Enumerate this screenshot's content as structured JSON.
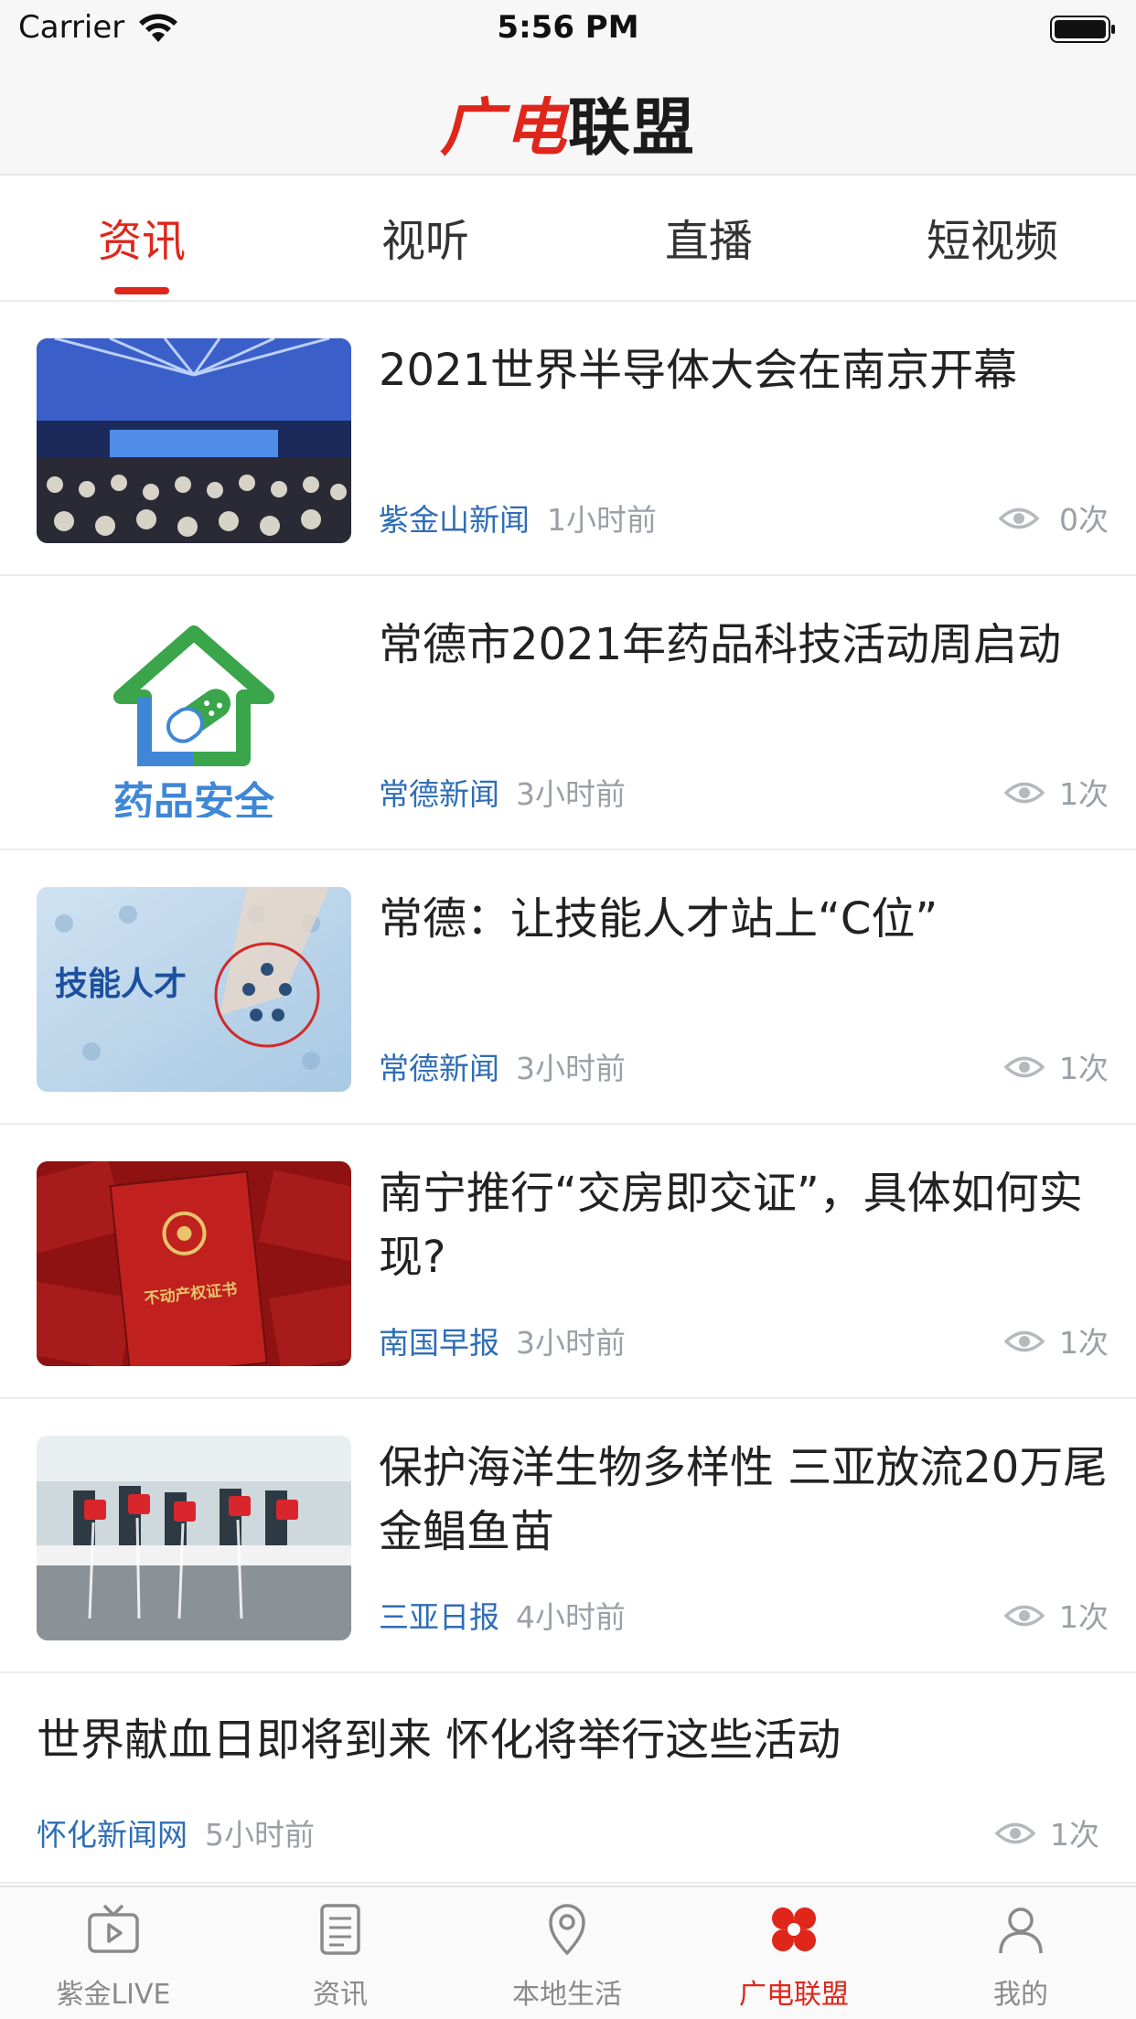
{
  "status_bar": {
    "carrier": "Carrier",
    "time": "5:56 PM"
  },
  "header": {
    "logo_red": "广电",
    "logo_dark": "联盟"
  },
  "tabs": [
    {
      "label": "资讯",
      "active": true
    },
    {
      "label": "视听",
      "active": false
    },
    {
      "label": "直播",
      "active": false
    },
    {
      "label": "短视频",
      "active": false
    }
  ],
  "news": [
    {
      "title": "2021世界半导体大会在南京开幕",
      "source": "紫金山新闻",
      "time": "1小时前",
      "views": "0次",
      "thumb": "conference-hall-photo"
    },
    {
      "title": "常德市2021年药品科技活动周启动",
      "source": "常德新闻",
      "time": "3小时前",
      "views": "1次",
      "thumb": "drug-safety-logo",
      "thumb_text": "药品安全"
    },
    {
      "title": "常德：让技能人才站上“C位”",
      "source": "常德新闻",
      "time": "3小时前",
      "views": "1次",
      "thumb": "skilled-talent-graphic",
      "thumb_text": "技能人才"
    },
    {
      "title": "南宁推行“交房即交证”，具体如何实现?",
      "source": "南国早报",
      "time": "3小时前",
      "views": "1次",
      "thumb": "property-certificate-photo",
      "thumb_text": "不动产权证书"
    },
    {
      "title": "保护海洋生物多样性 三亚放流20万尾金鲳鱼苗",
      "source": "三亚日报",
      "time": "4小时前",
      "views": "1次",
      "thumb": "fish-release-photo"
    },
    {
      "title": "世界献血日即将到来 怀化将举行这些活动",
      "source": "怀化新闻网",
      "time": "5小时前",
      "views": "1次"
    }
  ],
  "tab_bar": [
    {
      "label": "紫金LIVE",
      "icon": "tv-play-icon",
      "active": false
    },
    {
      "label": "资讯",
      "icon": "news-list-icon",
      "active": false
    },
    {
      "label": "本地生活",
      "icon": "location-pin-icon",
      "active": false
    },
    {
      "label": "广电联盟",
      "icon": "alliance-flower-icon",
      "active": true
    },
    {
      "label": "我的",
      "icon": "profile-icon",
      "active": false
    }
  ],
  "colors": {
    "accent": "#e0261b",
    "source_blue": "#2f6db5",
    "muted": "#9aa0a6"
  }
}
